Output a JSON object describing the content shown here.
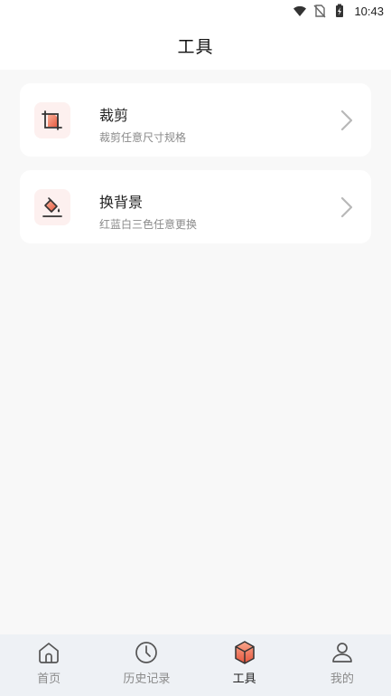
{
  "status_bar": {
    "time": "10:43",
    "icons": [
      "wifi-icon",
      "no-sim-icon",
      "battery-charging-icon"
    ]
  },
  "header": {
    "title": "工具"
  },
  "tools": [
    {
      "title": "裁剪",
      "subtitle": "裁剪任意尺寸规格",
      "icon": "crop-icon"
    },
    {
      "title": "换背景",
      "subtitle": "红蓝白三色任意更换",
      "icon": "paint-bucket-icon"
    }
  ],
  "tabbar": {
    "items": [
      {
        "label": "首页",
        "icon": "home-icon",
        "active": false
      },
      {
        "label": "历史记录",
        "icon": "clock-icon",
        "active": false
      },
      {
        "label": "工具",
        "icon": "cube-icon",
        "active": true
      },
      {
        "label": "我的",
        "icon": "user-icon",
        "active": false
      }
    ]
  },
  "colors": {
    "accent": "#f07a5f",
    "accent_dark": "#e5563d",
    "icon_bg": "#fdf0ef",
    "tabbar_bg": "#eef1f5",
    "page_bg": "#f8f8f8"
  }
}
